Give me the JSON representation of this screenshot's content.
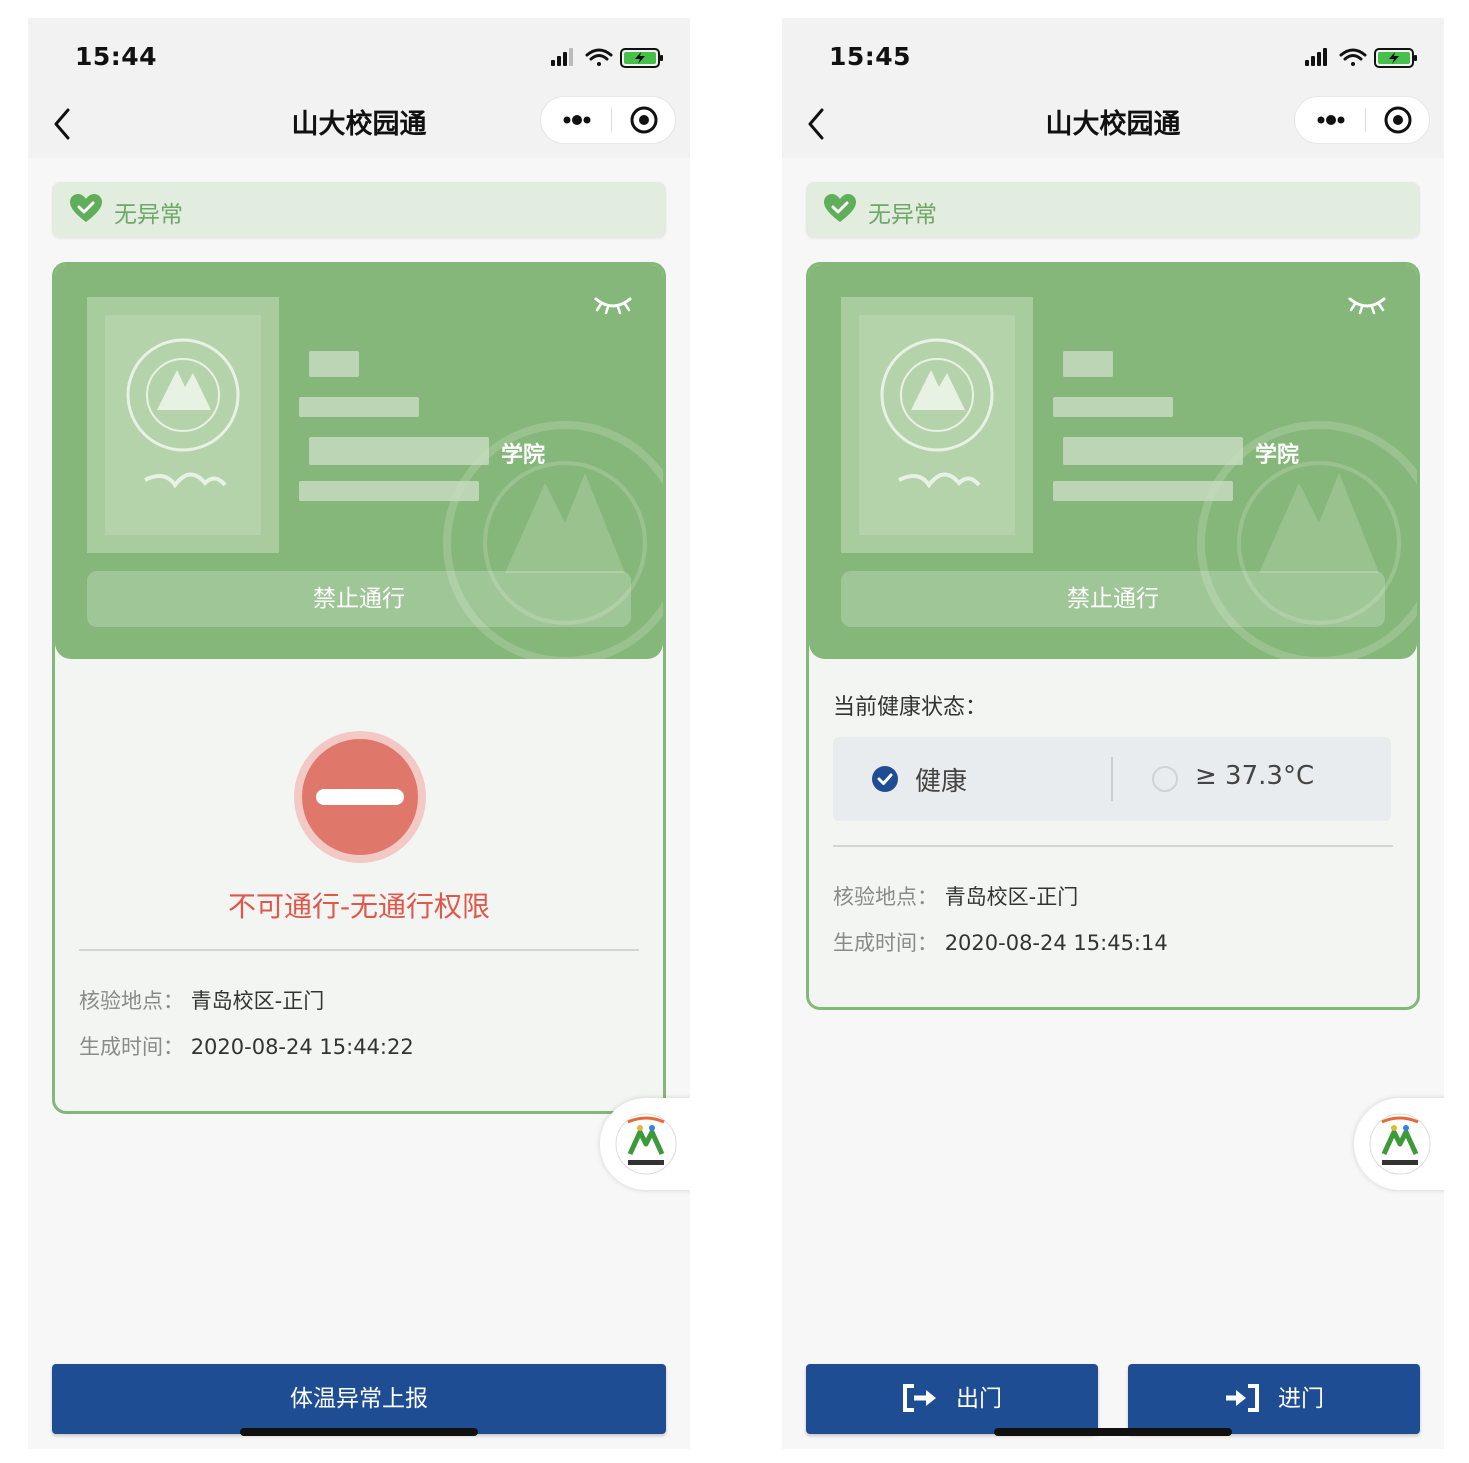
{
  "left": {
    "time": "15:44",
    "nav_title": "山大校园通",
    "status_banner": "无异常",
    "college_suffix": "学院",
    "card_button": "禁止通行",
    "deny_message": "不可通行-无通行权限",
    "location_label": "核验地点：",
    "location_value": "青岛校区-正门",
    "time_label": "生成时间：",
    "time_value": "2020-08-24 15:44:22",
    "bottom_button": "体温异常上报"
  },
  "right": {
    "time": "15:45",
    "nav_title": "山大校园通",
    "status_banner": "无异常",
    "college_suffix": "学院",
    "card_button": "禁止通行",
    "health_label": "当前健康状态：",
    "health_options": [
      {
        "label": "健康",
        "selected": true
      },
      {
        "label": "≥ 37.3°C",
        "selected": false
      }
    ],
    "location_label": "核验地点：",
    "location_value": "青岛校区-正门",
    "time_label": "生成时间：",
    "time_value": "2020-08-24 15:45:14",
    "exit_button": "出门",
    "enter_button": "进门"
  },
  "colors": {
    "card_green": "#85b77a",
    "banner_green": "#e2ecdf",
    "banner_text": "#6ea866",
    "deny_red": "#e0574c",
    "button_blue": "#1e4d94",
    "check_blue": "#1e4d94"
  },
  "icons": [
    "signal-icon",
    "wifi-icon",
    "battery-icon",
    "back-icon",
    "more-icon",
    "target-icon",
    "heart-check-icon",
    "eye-closed-icon",
    "no-entry-icon",
    "check-icon",
    "radio-icon",
    "exit-icon",
    "enter-icon"
  ]
}
